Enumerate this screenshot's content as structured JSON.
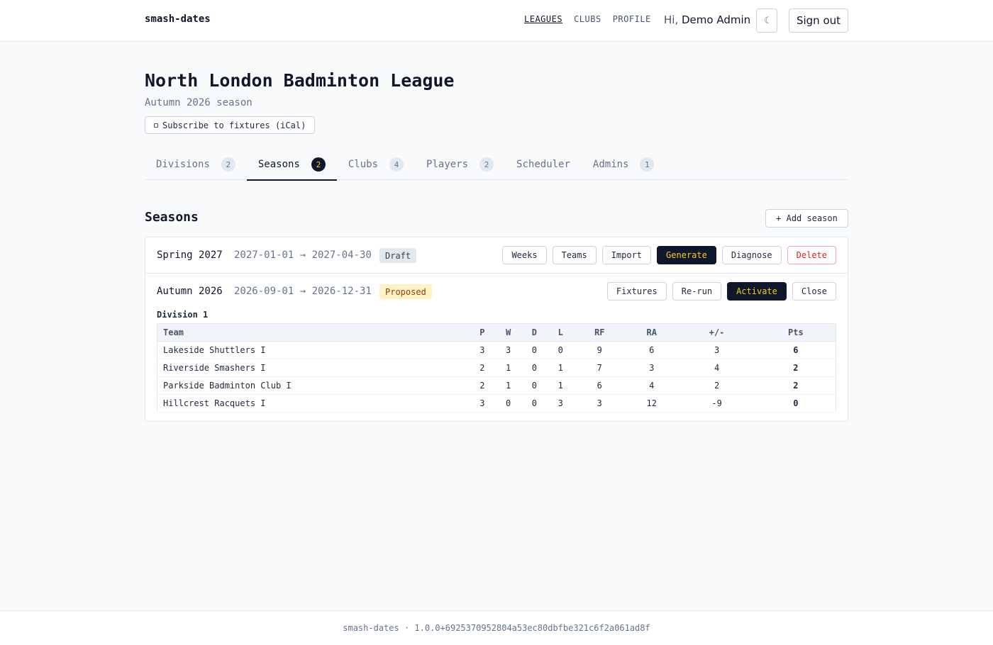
{
  "header": {
    "brand": "smash-dates",
    "nav": [
      {
        "label": "LEAGUES",
        "active": true
      },
      {
        "label": "CLUBS",
        "active": false
      },
      {
        "label": "PROFILE",
        "active": false
      }
    ],
    "greeting_prefix": "Hi,",
    "user_name": "Demo Admin",
    "theme_icon": "☾",
    "sign_out_label": "Sign out"
  },
  "league": {
    "title": "North London Badminton League",
    "subtitle": "Autumn 2026 season",
    "ical_label": "Subscribe to fixtures (iCal)"
  },
  "tabs": [
    {
      "label": "Divisions",
      "count": "2",
      "active": false
    },
    {
      "label": "Seasons",
      "count": "2",
      "active": true
    },
    {
      "label": "Clubs",
      "count": "4",
      "active": false
    },
    {
      "label": "Players",
      "count": "2",
      "active": false
    },
    {
      "label": "Scheduler",
      "count": null,
      "active": false
    },
    {
      "label": "Admins",
      "count": "1",
      "active": false
    }
  ],
  "seasons_section": {
    "title": "Seasons",
    "add_label": "+ Add season"
  },
  "seasons": [
    {
      "name": "Spring 2027",
      "dates": "2027-01-01 → 2027-04-30",
      "status": "Draft",
      "actions": [
        "Weeks",
        "Teams",
        "Import",
        "Generate",
        "Diagnose",
        "Delete"
      ]
    },
    {
      "name": "Autumn 2026",
      "dates": "2026-09-01 → 2026-12-31",
      "status": "Proposed",
      "actions": [
        "Fixtures",
        "Re-run",
        "Activate",
        "Close"
      ]
    }
  ],
  "standings": {
    "division": "Division 1",
    "columns": [
      "Team",
      "P",
      "W",
      "D",
      "L",
      "RF",
      "RA",
      "+/-",
      "Pts"
    ],
    "rows": [
      [
        "Lakeside Shuttlers I",
        "3",
        "3",
        "0",
        "0",
        "9",
        "6",
        "3",
        "6"
      ],
      [
        "Riverside Smashers I",
        "2",
        "1",
        "0",
        "1",
        "7",
        "3",
        "4",
        "2"
      ],
      [
        "Parkside Badminton Club I",
        "2",
        "1",
        "0",
        "1",
        "6",
        "4",
        "2",
        "2"
      ],
      [
        "Hillcrest Racquets I",
        "3",
        "0",
        "0",
        "3",
        "3",
        "12",
        "-9",
        "0"
      ]
    ]
  },
  "footer": {
    "text": "smash-dates · 1.0.0+6925370952804a53ec80dbfbe321c6f2a061ad8f"
  },
  "colors": {
    "primary": "#0f172a",
    "accent": "#facc15",
    "danger": "#dc2626"
  }
}
